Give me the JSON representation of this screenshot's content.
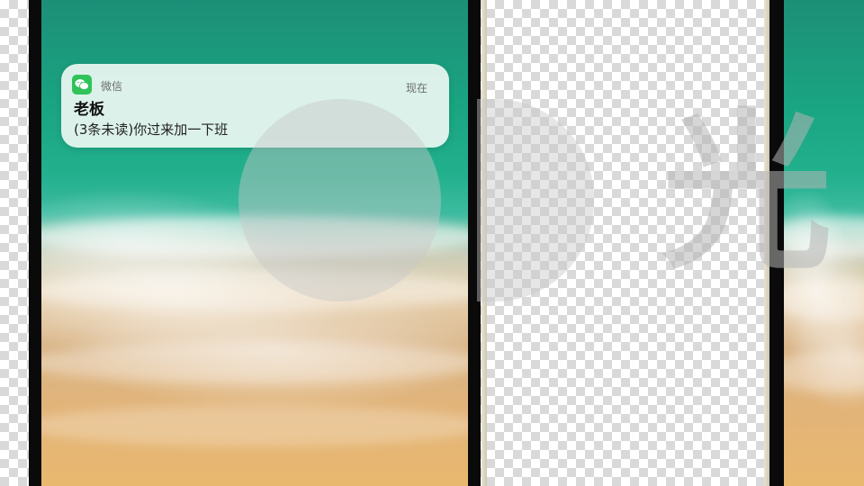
{
  "notification": {
    "app_name": "微信",
    "time": "现在",
    "sender": "老板",
    "message": "(3条未读)你过来加一下班"
  },
  "watermark": {
    "glyph": "光"
  },
  "colors": {
    "wechat_green": "#2fc35a",
    "notification_bg": "#ecf7f2",
    "sea_teal": "#1aa582",
    "sand": "#e3b477"
  },
  "icons": {
    "app_icon": "wechat-icon"
  }
}
